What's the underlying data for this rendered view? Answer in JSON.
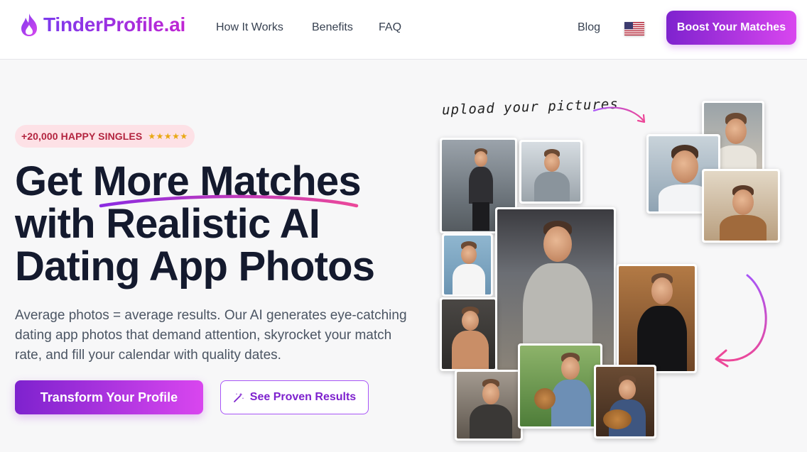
{
  "nav": {
    "logo_text": "TinderProfile.ai",
    "links": [
      "How It Works",
      "Benefits",
      "FAQ"
    ],
    "blog": "Blog",
    "flag_icon": "us-flag-icon",
    "boost_button": "Boost Your Matches"
  },
  "hero": {
    "badge_text": "+20,000 HAPPY SINGLES",
    "badge_stars": "★★★★★",
    "headline": {
      "line1": "Get More Matches",
      "line2": "with Realistic AI",
      "line3": "Dating App Photos"
    },
    "subtext": "Average photos = average results. Our AI generates eye-catching dating app photos that demand attention, skyrocket your match rate, and fill your calendar with quality dates.",
    "primary_cta": "Transform Your Profile",
    "secondary_cta": "See Proven Results",
    "secondary_cta_icon": "magic-wand-icon"
  },
  "gallery": {
    "upload_label": "upload your pictures"
  },
  "colors": {
    "brand_purple": "#7e22ce",
    "brand_pink": "#d946ef",
    "headline": "#141a2e",
    "badge_bg": "#fde1e6"
  }
}
